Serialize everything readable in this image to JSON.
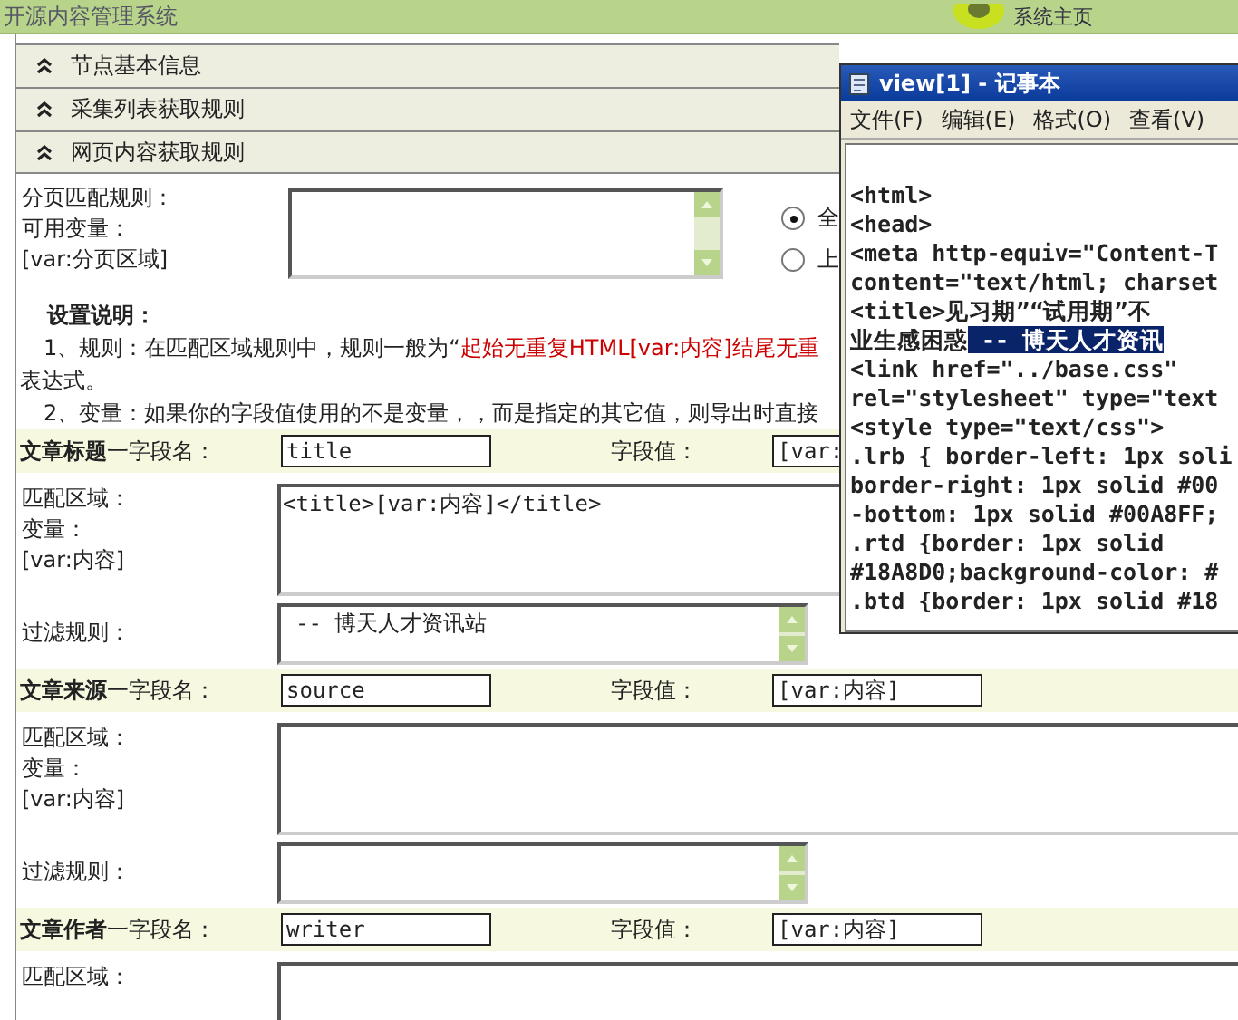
{
  "header": {
    "title": "开源内容管理系统",
    "home_link": "系统主页"
  },
  "sections": [
    {
      "label": "节点基本信息"
    },
    {
      "label": "采集列表获取规则"
    },
    {
      "label": "网页内容获取规则"
    }
  ],
  "pagination": {
    "labels": [
      "分页匹配规则：",
      "可用变量：",
      "[var:分页区域]"
    ],
    "options": [
      {
        "label": "全",
        "selected": true
      },
      {
        "label": "上",
        "selected": false
      }
    ]
  },
  "notes": {
    "title": "设置说明：",
    "lines": [
      {
        "kind": "item",
        "parts": [
          {
            "text": "1、规则：在匹配区域规则中，规则一般为“",
            "highlight": false
          },
          {
            "text": "起始无重复HTML[var:内容]结尾无重",
            "highlight": true
          }
        ]
      },
      {
        "kind": "continuation",
        "parts": [
          {
            "text": "表达式。",
            "highlight": false
          }
        ]
      },
      {
        "kind": "item",
        "parts": [
          {
            "text": "2、变量：如果你的字段值使用的不是变量，，而是指定的其它值，则导出时直接",
            "highlight": false
          }
        ]
      }
    ]
  },
  "fields": [
    {
      "title": "文章标题",
      "name_label": "一字段名：",
      "name": "title",
      "value_label": "字段值：",
      "value": "[var:",
      "match_labels": [
        "匹配区域：",
        "变量：",
        "[var:内容]"
      ],
      "match": "<title>[var:内容]</title>",
      "filter_label": "过滤规则：",
      "filter": "-- 博天人才资讯站"
    },
    {
      "title": "文章来源",
      "name_label": "一字段名：",
      "name": "source",
      "value_label": "字段值：",
      "value": "[var:内容]",
      "match_labels": [
        "匹配区域：",
        "变量：",
        "[var:内容]"
      ],
      "filter_label": "过滤规则："
    },
    {
      "title": "文章作者",
      "name_label": "一字段名：",
      "name": "writer",
      "value_label": "字段值：",
      "value": "[var:内容]",
      "match_labels": [
        "匹配区域："
      ]
    }
  ],
  "notepad": {
    "title": "view[1] - 记事本",
    "menu": [
      "文件(F)",
      "编辑(E)",
      "格式(O)",
      "查看(V)"
    ],
    "lines": [
      {
        "text": "<html>"
      },
      {
        "text": "<head>"
      },
      {
        "text": "<meta http-equiv=\"Content-T"
      },
      {
        "text": "content=\"text/html; charset"
      },
      {
        "text": "<title>见习期”“试用期”不"
      },
      {
        "parts": [
          {
            "text": "业生感困惑",
            "selected": false
          },
          {
            "text": " -- 博天人才资讯",
            "selected": true
          }
        ]
      },
      {
        "text": "<link href=\"../base.css\""
      },
      {
        "text": "rel=\"stylesheet\" type=\"text"
      },
      {
        "text": "<style type=\"text/css\">"
      },
      {
        "text": ".lrb { border-left: 1px soli"
      },
      {
        "text": "border-right: 1px solid #00"
      },
      {
        "text": "-bottom: 1px solid #00A8FF;"
      },
      {
        "text": ".rtd {border: 1px solid"
      },
      {
        "text": "#18A8D0;background-color: #"
      },
      {
        "text": ".btd {border: 1px solid #18"
      }
    ]
  }
}
